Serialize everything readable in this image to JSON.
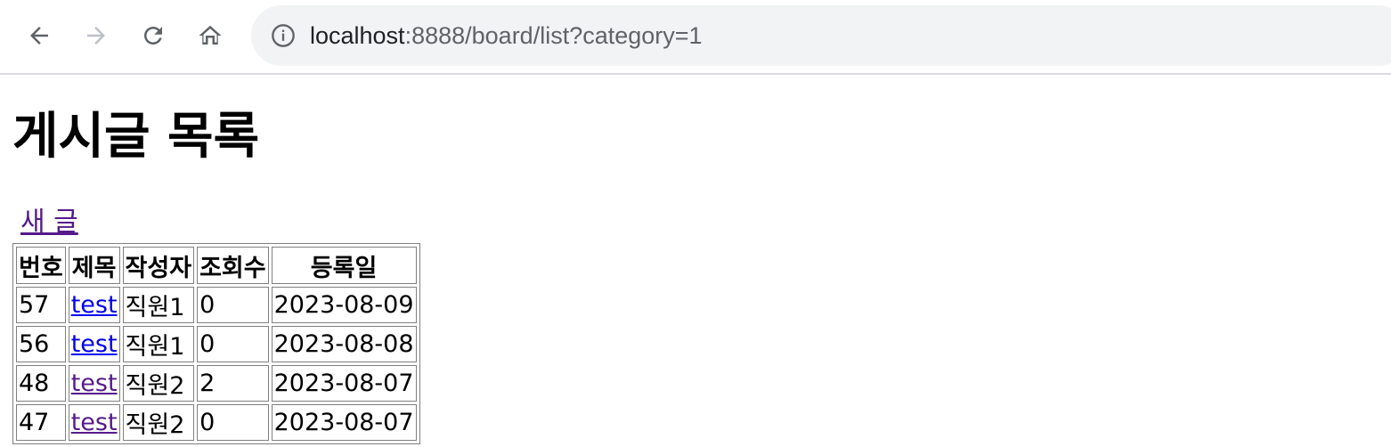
{
  "browser": {
    "url_host": "localhost",
    "url_rest": ":8888/board/list?category=1"
  },
  "page": {
    "title": "게시글 목록",
    "new_post_link": "새 글"
  },
  "table": {
    "headers": [
      "번호",
      "제목",
      "작성자",
      "조회수",
      "등록일"
    ],
    "rows": [
      {
        "no": "57",
        "title": "test",
        "author": "직원1",
        "views": "0",
        "date": "2023-08-09",
        "visited": false
      },
      {
        "no": "56",
        "title": "test",
        "author": "직원1",
        "views": "0",
        "date": "2023-08-08",
        "visited": false
      },
      {
        "no": "48",
        "title": "test",
        "author": "직원2",
        "views": "2",
        "date": "2023-08-07",
        "visited": true
      },
      {
        "no": "47",
        "title": "test",
        "author": "직원2",
        "views": "0",
        "date": "2023-08-07",
        "visited": true
      }
    ]
  },
  "colors": {
    "link_unvisited": "#0000ee",
    "link_visited": "#551a8b",
    "toolbar_bg": "#ffffff",
    "omnibox_bg": "#f1f3f4"
  }
}
